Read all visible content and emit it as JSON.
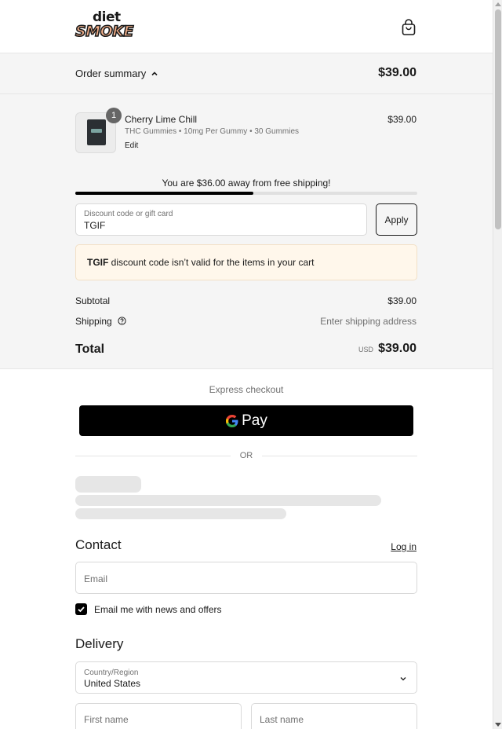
{
  "header": {
    "logo_top": "diet",
    "logo_bottom": "SMOKE",
    "cart_icon": "shopping-bag-icon"
  },
  "summary": {
    "toggle_label": "Order summary",
    "toggle_icon": "chevron-up-icon",
    "total": "$39.00"
  },
  "line_item": {
    "quantity": "1",
    "name": "Cherry Lime Chill",
    "variant": "THC Gummies • 10mg Per Gummy • 30 Gummies",
    "edit_label": "Edit",
    "price": "$39.00"
  },
  "shipping_progress": {
    "message": "You are $36.00 away from free shipping!",
    "progress_fraction": 0.52
  },
  "discount": {
    "label": "Discount code or gift card",
    "value": "TGIF",
    "apply_label": "Apply"
  },
  "notice": {
    "code": "TGIF",
    "message": " discount code isn’t valid for the items in your cart"
  },
  "totals": {
    "subtotal_label": "Subtotal",
    "subtotal_value": "$39.00",
    "shipping_label": "Shipping",
    "shipping_value": "Enter shipping address",
    "total_label": "Total",
    "currency": "USD",
    "total_value": "$39.00"
  },
  "express": {
    "label": "Express checkout",
    "gpay_label": "Pay",
    "or_label": "OR"
  },
  "contact": {
    "title": "Contact",
    "login_label": "Log in",
    "email_placeholder": "Email",
    "newsletter_label": "Email me with news and offers",
    "newsletter_checked": true
  },
  "delivery": {
    "title": "Delivery",
    "country_label": "Country/Region",
    "country_value": "United States",
    "first_name_placeholder": "First name",
    "last_name_placeholder": "Last name"
  },
  "colors": {
    "panel_bg": "#f5f5f5",
    "notice_bg": "#fff7eb",
    "accent": "#000000",
    "logo_fill": "#f4b08a"
  }
}
